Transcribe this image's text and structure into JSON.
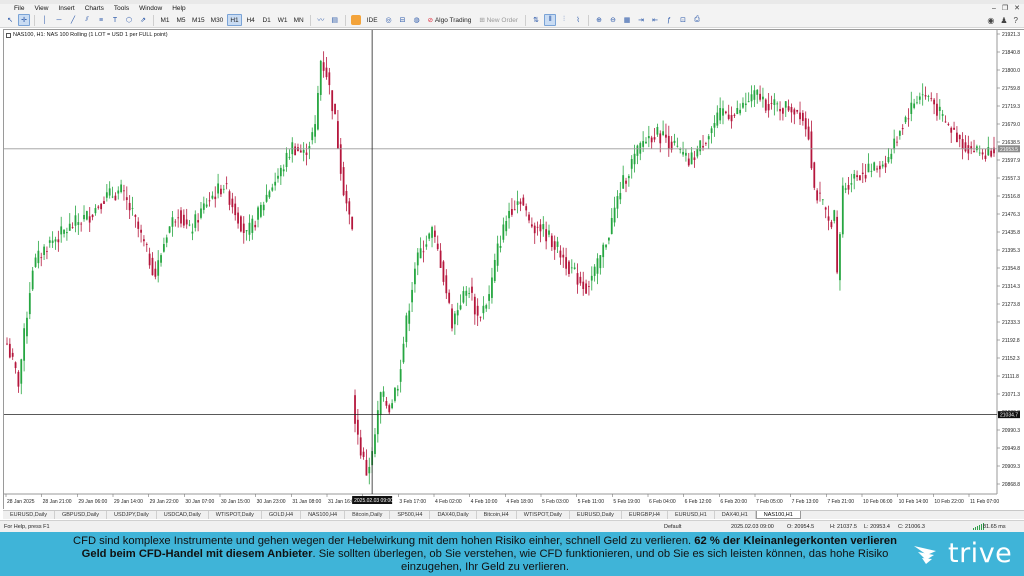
{
  "menu": [
    "File",
    "View",
    "Insert",
    "Charts",
    "Tools",
    "Window",
    "Help"
  ],
  "toolbar": {
    "timeframes": [
      "M1",
      "M5",
      "M15",
      "M30",
      "H1",
      "H4",
      "D1",
      "W1",
      "MN"
    ],
    "active_timeframe": "H1",
    "ide_label": "IDE",
    "algo_label": "Algo Trading",
    "new_order_label": "New Order"
  },
  "chart": {
    "info": "NAS100, H1:  NAS 100 Rolling (1 LOT = USD 1 per FULL point)",
    "current_price_label": "21653.5",
    "crosshair_price_label": "21034.7",
    "crosshair_time_label": "2025.02.03 09:00",
    "price_axis": [
      "21921.3",
      "21840.8",
      "21800.0",
      "21759.8",
      "21719.3",
      "21679.0",
      "21638.5",
      "21597.9",
      "21557.3",
      "21516.8",
      "21476.3",
      "21435.8",
      "21395.3",
      "21354.8",
      "21314.3",
      "21273.8",
      "21233.3",
      "21192.8",
      "21152.3",
      "21111.8",
      "21071.3",
      "21030.8",
      "20990.3",
      "20949.8",
      "20909.3",
      "20868.8"
    ],
    "time_axis": [
      "28 Jan 2025",
      "28 Jan 21:00",
      "29 Jan 06:00",
      "29 Jan 14:00",
      "29 Jan 22:00",
      "30 Jan 07:00",
      "30 Jan 15:00",
      "30 Jan 23:00",
      "31 Jan 08:00",
      "31 Jan 16:00",
      "3 Feb 00:00",
      "3 Feb 17:00",
      "4 Feb 02:00",
      "4 Feb 10:00",
      "4 Feb 18:00",
      "5 Feb 03:00",
      "5 Feb 11:00",
      "5 Feb 19:00",
      "6 Feb 04:00",
      "6 Feb 12:00",
      "6 Feb 20:00",
      "7 Feb 05:00",
      "7 Feb 13:00",
      "7 Feb 21:00",
      "10 Feb 06:00",
      "10 Feb 14:00",
      "10 Feb 22:00",
      "11 Feb 07:00"
    ],
    "colors": {
      "bull": "#26a641",
      "bear": "#b5173d",
      "grid": "#e6e6e6"
    }
  },
  "tabs": [
    "EURUSD,Daily",
    "GBPUSD,Daily",
    "USDJPY,Daily",
    "USDCAD,Daily",
    "WTISPOT,Daily",
    "GOLD,H4",
    "NAS100,H4",
    "Bitcoin,Daily",
    "SP500,H4",
    "DAX40,Daily",
    "Bitcoin,H4",
    "WTISPOT,Daily",
    "EURUSD,Daily",
    "EURGBP,H4",
    "EURUSD,H1",
    "DAX40,H1",
    "NAS100,H1"
  ],
  "active_tab": "NAS100,H1",
  "status": {
    "help": "For Help, press F1",
    "profile": "Default",
    "time": "2025.02.03 09:00",
    "open": "O: 20954.5",
    "high": "H: 21037.5",
    "low": "L: 20953.4",
    "close": "C: 21006.3",
    "speed": "81.65 ms"
  },
  "banner": {
    "text_a": "CFD sind komplexe Instrumente und gehen wegen der Hebelwirkung mit dem hohen Risiko einher, schnell Geld zu verlieren. ",
    "text_b": "62 % der Kleinanlegerkonten verlieren Geld beim CFD-Handel mit diesem Anbieter",
    "text_c": ". Sie sollten überlegen, ob Sie verstehen, wie CFD funktionieren, und ob Sie es sich leisten können, das hohe Risiko einzugehen, Ihr Geld zu verlieren.",
    "logo": "trive"
  },
  "chart_data": {
    "type": "candlestick",
    "symbol": "NAS100",
    "timeframe": "H1",
    "ylim": [
      20850,
      21930
    ],
    "current_price": 21653.5,
    "crosshair_price": 21034.7,
    "close_path": [
      [
        0,
        21200
      ],
      [
        4,
        21110
      ],
      [
        9,
        21380
      ],
      [
        14,
        21430
      ],
      [
        18,
        21450
      ],
      [
        24,
        21480
      ],
      [
        29,
        21500
      ],
      [
        34,
        21540
      ],
      [
        40,
        21555
      ],
      [
        44,
        21500
      ],
      [
        48,
        21430
      ],
      [
        52,
        21360
      ],
      [
        56,
        21460
      ],
      [
        60,
        21510
      ],
      [
        64,
        21460
      ],
      [
        70,
        21530
      ],
      [
        76,
        21570
      ],
      [
        80,
        21510
      ],
      [
        84,
        21450
      ],
      [
        88,
        21500
      ],
      [
        92,
        21560
      ],
      [
        96,
        21600
      ],
      [
        100,
        21660
      ],
      [
        104,
        21640
      ],
      [
        108,
        21700
      ],
      [
        110,
        21860
      ],
      [
        112,
        21830
      ],
      [
        115,
        21720
      ],
      [
        118,
        21560
      ],
      [
        121,
        21460
      ],
      [
        122,
        21020
      ],
      [
        124,
        20950
      ],
      [
        126,
        20900
      ],
      [
        128,
        20940
      ],
      [
        131,
        21080
      ],
      [
        134,
        21050
      ],
      [
        137,
        21110
      ],
      [
        140,
        21250
      ],
      [
        143,
        21380
      ],
      [
        146,
        21430
      ],
      [
        149,
        21460
      ],
      [
        152,
        21390
      ],
      [
        156,
        21250
      ],
      [
        159,
        21300
      ],
      [
        162,
        21330
      ],
      [
        165,
        21260
      ],
      [
        169,
        21310
      ],
      [
        172,
        21420
      ],
      [
        176,
        21510
      ],
      [
        180,
        21540
      ],
      [
        183,
        21480
      ],
      [
        187,
        21470
      ],
      [
        191,
        21440
      ],
      [
        195,
        21400
      ],
      [
        199,
        21360
      ],
      [
        203,
        21330
      ],
      [
        207,
        21380
      ],
      [
        211,
        21460
      ],
      [
        215,
        21560
      ],
      [
        219,
        21620
      ],
      [
        223,
        21670
      ],
      [
        227,
        21690
      ],
      [
        231,
        21680
      ],
      [
        235,
        21650
      ],
      [
        239,
        21620
      ],
      [
        243,
        21660
      ],
      [
        247,
        21700
      ],
      [
        251,
        21740
      ],
      [
        255,
        21730
      ],
      [
        259,
        21760
      ],
      [
        263,
        21780
      ],
      [
        266,
        21760
      ],
      [
        270,
        21750
      ],
      [
        274,
        21750
      ],
      [
        278,
        21740
      ],
      [
        281,
        21690
      ],
      [
        283,
        21560
      ],
      [
        286,
        21520
      ],
      [
        288,
        21480
      ],
      [
        290,
        21500
      ],
      [
        291,
        21350
      ],
      [
        293,
        21560
      ],
      [
        297,
        21590
      ],
      [
        301,
        21600
      ],
      [
        305,
        21610
      ],
      [
        309,
        21630
      ],
      [
        313,
        21700
      ],
      [
        317,
        21750
      ],
      [
        320,
        21780
      ],
      [
        324,
        21770
      ],
      [
        328,
        21720
      ],
      [
        332,
        21690
      ],
      [
        336,
        21660
      ],
      [
        339,
        21650
      ],
      [
        343,
        21640
      ],
      [
        346,
        21660
      ]
    ]
  }
}
